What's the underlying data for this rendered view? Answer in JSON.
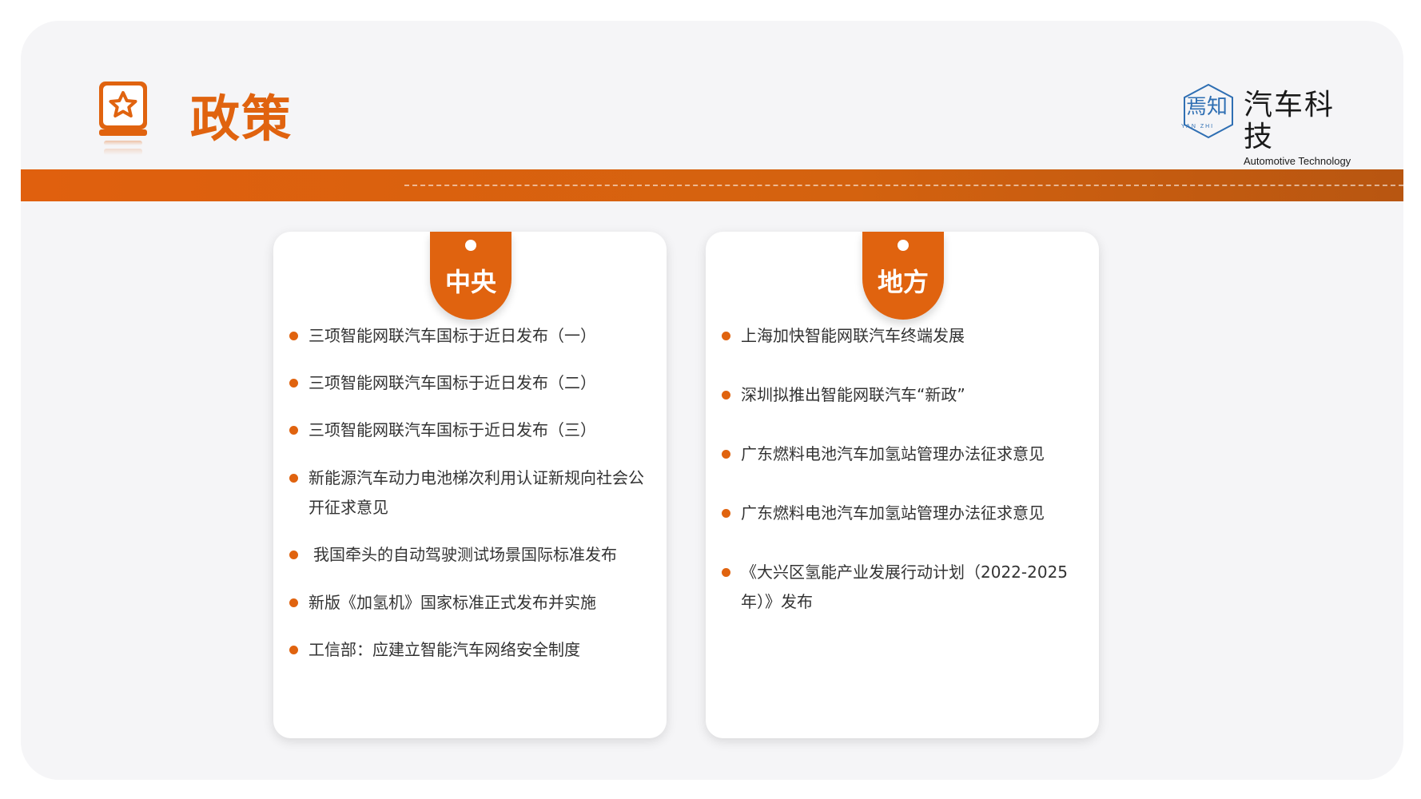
{
  "header": {
    "title": "政策",
    "icon": "star-book-icon",
    "logo": {
      "mark_cn": "焉知",
      "mark_en": "YAN ZHI",
      "name_cn": "汽车科技",
      "name_en": "Automotive Technology"
    }
  },
  "colors": {
    "accent": "#e0630f",
    "background": "#f5f5f7",
    "card": "#ffffff",
    "logo_blue": "#2f6fb3"
  },
  "central": {
    "label": "中央",
    "items": [
      "三项智能网联汽车国标于近日发布（一）",
      "三项智能网联汽车国标于近日发布（二）",
      "三项智能网联汽车国标于近日发布（三）",
      "新能源汽车动力电池梯次利用认证新规向社会公开征求意见",
      "我国牵头的自动驾驶测试场景国际标准发布",
      "新版《加氢机》国家标准正式发布并实施",
      "工信部：应建立智能汽车网络安全制度"
    ]
  },
  "local": {
    "label": "地方",
    "items": [
      "上海加快智能网联汽车终端发展",
      "深圳拟推出智能网联汽车“新政”",
      "广东燃料电池汽车加氢站管理办法征求意见",
      "广东燃料电池汽车加氢站管理办法征求意见",
      "《大兴区氢能产业发展行动计划（2022-2025年）》发布"
    ]
  }
}
